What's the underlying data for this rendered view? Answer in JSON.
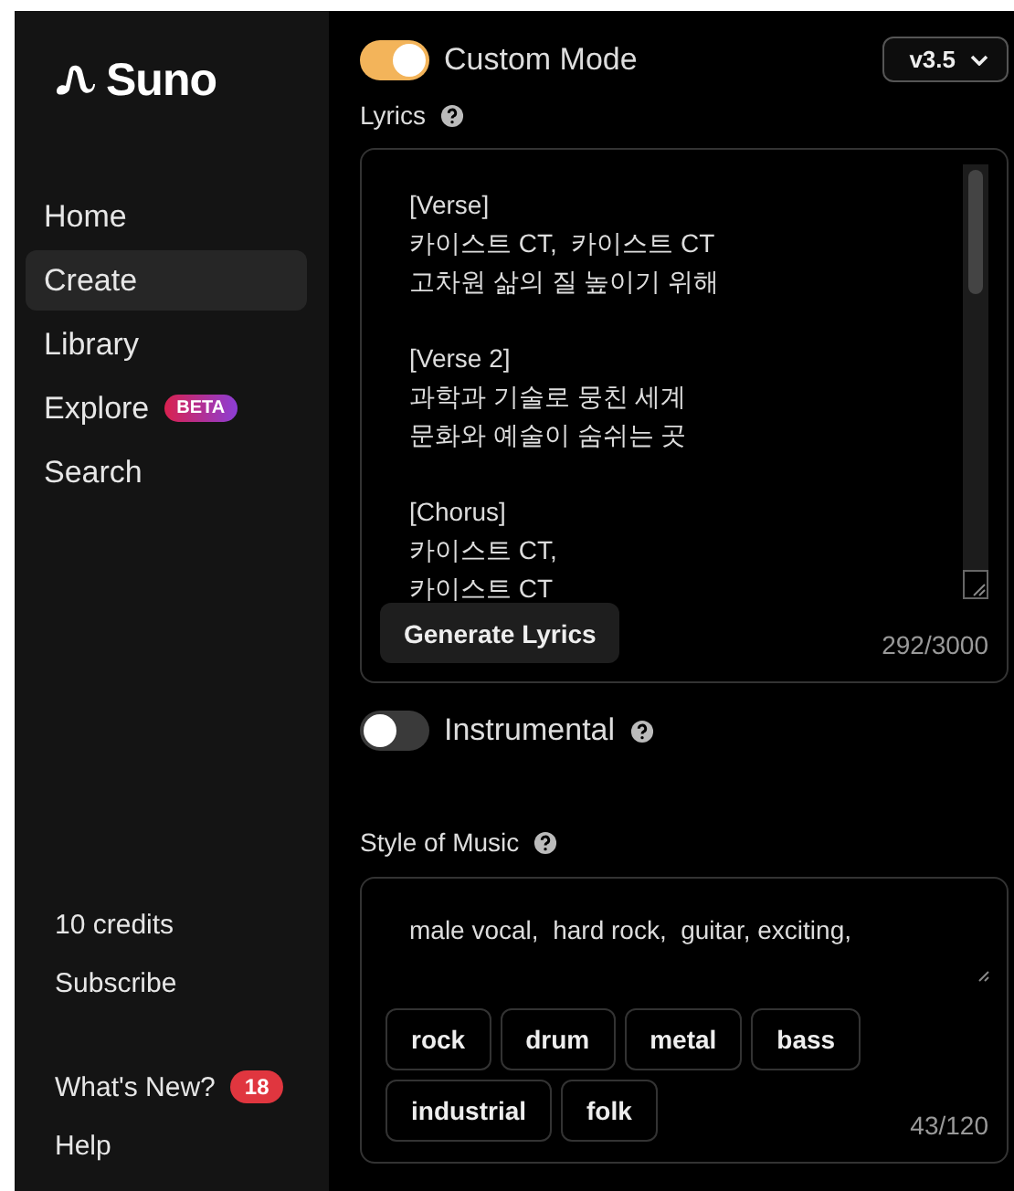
{
  "sidebar": {
    "logo": "Suno",
    "nav": [
      {
        "label": "Home",
        "selected": false
      },
      {
        "label": "Create",
        "selected": true
      },
      {
        "label": "Library",
        "selected": false
      },
      {
        "label": "Explore",
        "selected": false,
        "badge": "BETA"
      },
      {
        "label": "Search",
        "selected": false
      }
    ],
    "credits": "10 credits",
    "subscribe": "Subscribe",
    "footer": [
      {
        "label": "What's New?",
        "badge": "18"
      },
      {
        "label": "Help"
      }
    ]
  },
  "custom_mode": {
    "label": "Custom Mode",
    "on": true
  },
  "version": {
    "value": "v3.5"
  },
  "lyrics": {
    "label": "Lyrics",
    "value": "[Verse]\n카이스트 CT,  카이스트 CT\n고차원 삶의 질 높이기 위해\n\n[Verse 2]\n과학과 기술로 뭉친 세계\n문화와 예술이 숨쉬는 곳\n\n[Chorus]\n카이스트 CT,\n카이스트 CT",
    "generate_button": "Generate Lyrics",
    "counter": "292/3000"
  },
  "instrumental": {
    "label": "Instrumental",
    "on": false
  },
  "style": {
    "label": "Style of Music",
    "value": "male vocal,  hard rock,  guitar, exciting,",
    "tags": [
      "rock",
      "drum",
      "metal",
      "bass",
      "industrial",
      "folk"
    ],
    "counter": "43/120"
  }
}
